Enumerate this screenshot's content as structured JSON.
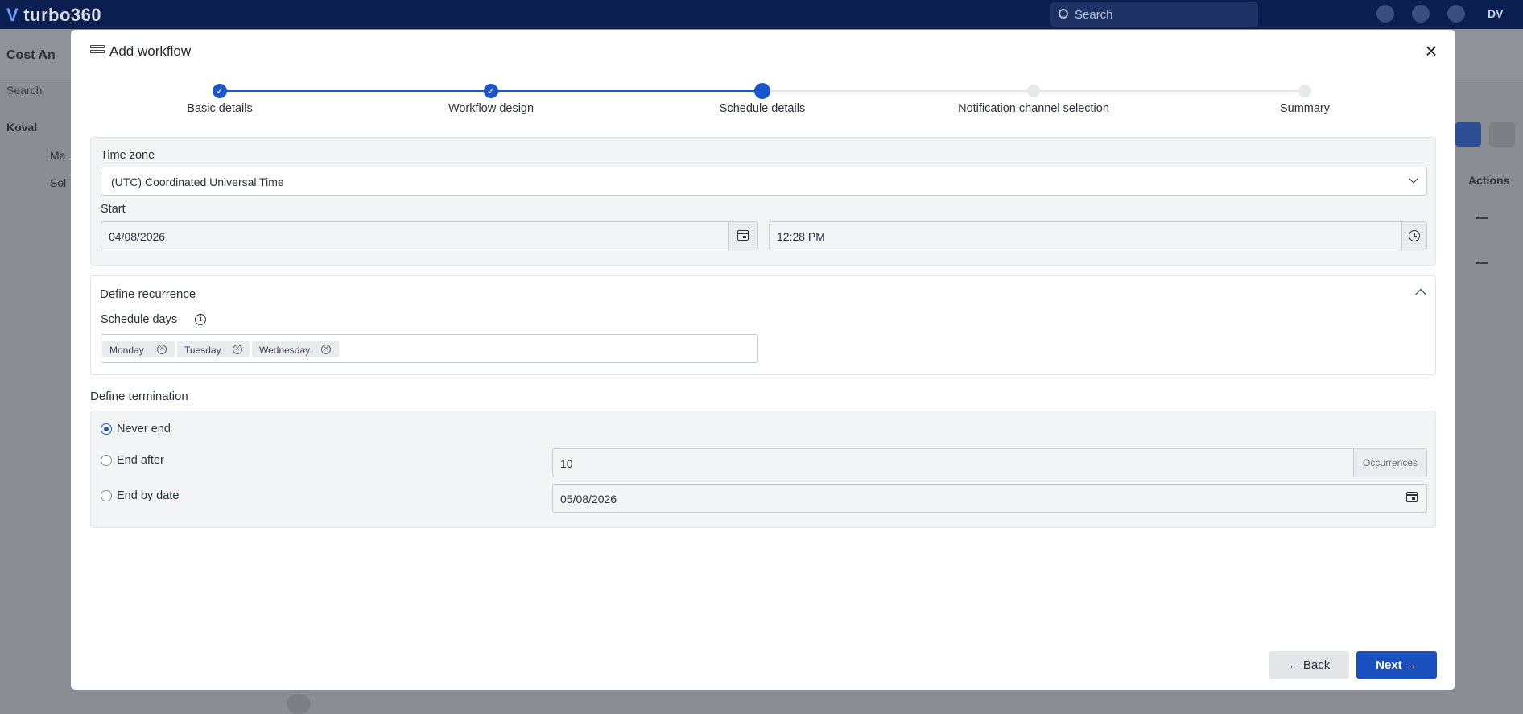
{
  "app": {
    "brand": "turbo360",
    "search_placeholder": "Search",
    "user_initials": "DV",
    "bg_title": "Cost An",
    "bg_search": "Search",
    "bg_tree_root": "Koval",
    "bg_tree_child1": "Ma",
    "bg_tree_child2": "Sol",
    "bg_actions": "Actions"
  },
  "modal": {
    "title": "Add workflow",
    "icon": "workflow-list-icon",
    "close_icon": "close-icon"
  },
  "stepper": {
    "steps": [
      {
        "label": "Basic details",
        "state": "done"
      },
      {
        "label": "Workflow design",
        "state": "done"
      },
      {
        "label": "Schedule details",
        "state": "current"
      },
      {
        "label": "Notification channel selection",
        "state": "todo"
      },
      {
        "label": "Summary",
        "state": "todo"
      }
    ],
    "accent": "#1a56c9"
  },
  "schedule": {
    "time_zone_label": "Time zone",
    "time_zone_value": "(UTC) Coordinated Universal Time",
    "start_label": "Start",
    "start_date": "04/08/2026",
    "start_time": "12:28 PM"
  },
  "recurrence": {
    "title": "Define recurrence",
    "schedule_days_label": "Schedule days",
    "days": [
      "Monday",
      "Tuesday",
      "Wednesday"
    ]
  },
  "termination": {
    "title": "Define termination",
    "options": [
      {
        "label": "Never end",
        "selected": true
      },
      {
        "label": "End after",
        "selected": false
      },
      {
        "label": "End by date",
        "selected": false
      }
    ],
    "occurrences_value": "10",
    "occurrences_suffix": "Occurrences",
    "end_date": "05/08/2026"
  },
  "footer": {
    "back_label": "Back",
    "next_label": "Next"
  }
}
